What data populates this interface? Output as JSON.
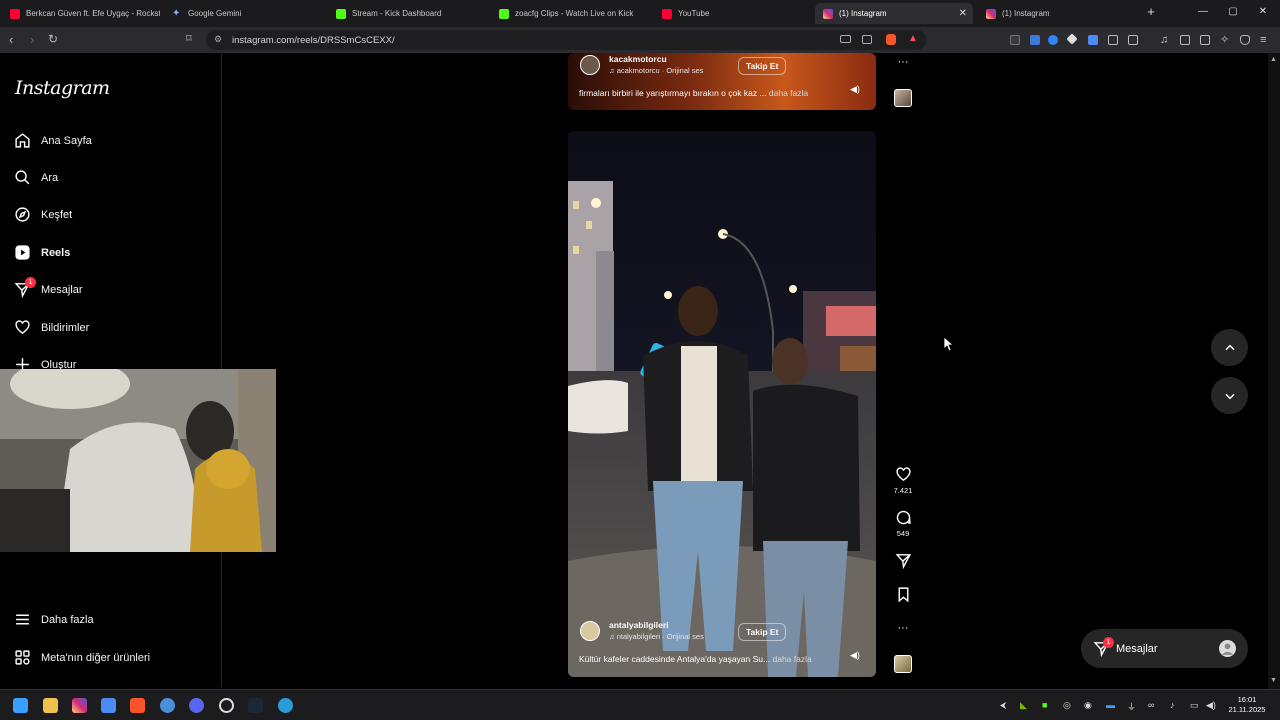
{
  "browser": {
    "tabs": [
      {
        "label": "Berkcan Güven ft. Efe Uygaç - Rockst",
        "favicon_color": "#ff0033",
        "active": false
      },
      {
        "label": "Google Gemini",
        "favicon_color": "#8ab4f8",
        "active": false
      },
      {
        "label": "Stream - Kick Dashboard",
        "favicon_color": "#53fc18",
        "active": false
      },
      {
        "label": "zoacfg Clips - Watch Live on Kick",
        "favicon_color": "#53fc18",
        "active": false
      },
      {
        "label": "YouTube",
        "favicon_color": "#ff0033",
        "active": false
      },
      {
        "label": "(1) Instagram",
        "favicon_color": "#e1306c",
        "active": true
      },
      {
        "label": "(1) Instagram",
        "favicon_color": "#e1306c",
        "active": false
      }
    ],
    "url": "instagram.com/reels/DRSSmCsCEXX/"
  },
  "sidebar": {
    "logo": "Instagram",
    "items": [
      {
        "label": "Ana Sayfa",
        "icon": "home-icon"
      },
      {
        "label": "Ara",
        "icon": "search-icon"
      },
      {
        "label": "Keşfet",
        "icon": "compass-icon"
      },
      {
        "label": "Reels",
        "icon": "reels-icon"
      },
      {
        "label": "Mesajlar",
        "icon": "messenger-icon",
        "badge": "1"
      },
      {
        "label": "Bildirimler",
        "icon": "heart-icon"
      },
      {
        "label": "Oluştur",
        "icon": "plus-icon"
      }
    ],
    "bottom": [
      {
        "label": "Daha fazla",
        "icon": "menu-icon"
      },
      {
        "label": "Meta'nın diğer ürünleri",
        "icon": "grid-icon"
      }
    ]
  },
  "reels": [
    {
      "username": "kacakmotorcu",
      "audio": "acakmotorcu · Orijinal ses",
      "follow_label": "Takip Et",
      "caption": "firmaları birbiri ile yarıştırmayı bırakın o çok kaz ...",
      "more_label": "daha fazla"
    },
    {
      "username": "antalyabilgileri",
      "audio": "ntalyabilgileri · Orijinal ses",
      "follow_label": "Takip Et",
      "caption": "Kültür kafeler caddesinde Antalya'da yaşayan Su...",
      "more_label": "daha fazla",
      "likes": "7.421",
      "comments": "549"
    }
  ],
  "messages_pill": {
    "label": "Mesajlar",
    "badge": "1"
  },
  "taskbar": {
    "time": "16:01",
    "date": "21.11.2025"
  },
  "colors": {
    "notification_red": "#ff3040",
    "background": "#000000",
    "surface": "#262626"
  }
}
